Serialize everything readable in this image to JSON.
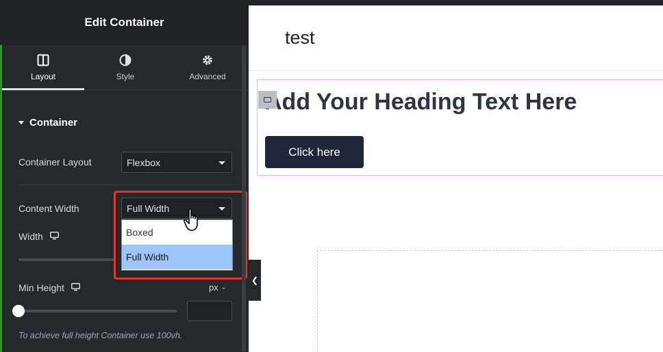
{
  "panel": {
    "title": "Edit Container",
    "tabs": [
      {
        "label": "Layout",
        "icon": "columns-icon",
        "active": true
      },
      {
        "label": "Style",
        "icon": "half-circle-icon",
        "active": false
      },
      {
        "label": "Advanced",
        "icon": "gear-icon",
        "active": false
      }
    ],
    "section_title": "Container",
    "container_layout": {
      "label": "Container Layout",
      "value": "Flexbox"
    },
    "content_width": {
      "label": "Content Width",
      "value": "Full Width",
      "options": [
        "Boxed",
        "Full Width"
      ],
      "selected_option": "Full Width"
    },
    "width": {
      "label": "Width"
    },
    "min_height": {
      "label": "Min Height",
      "unit": "px",
      "value": ""
    },
    "hint": "To achieve full height Container use 100vh."
  },
  "canvas": {
    "site_title": "test",
    "heading": "Add Your Heading Text Here",
    "button_label": "Click here"
  },
  "colors": {
    "panel_bg": "#26292c",
    "highlight": "#e0352e",
    "selected_option": "#9ec5fb",
    "button_bg": "#1e2739",
    "heading": "#2c3446"
  }
}
